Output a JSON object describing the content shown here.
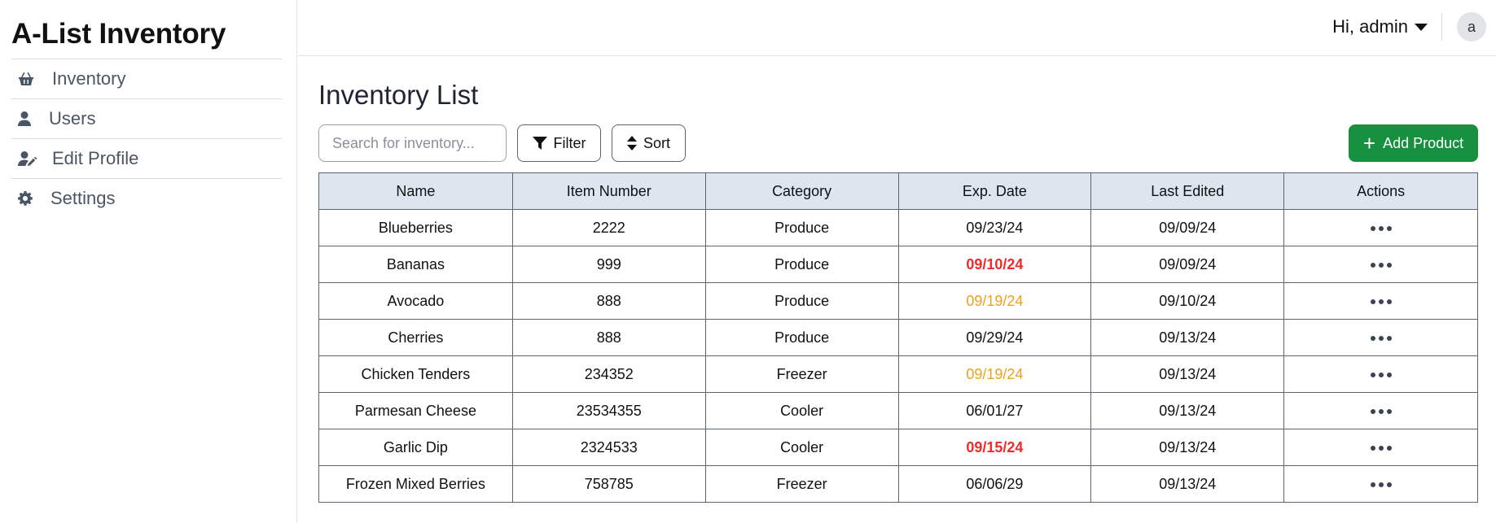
{
  "app": {
    "title": "A-List Inventory"
  },
  "sidebar": {
    "items": [
      {
        "label": "Inventory",
        "icon": "basket-icon"
      },
      {
        "label": "Users",
        "icon": "user-icon"
      },
      {
        "label": "Edit Profile",
        "icon": "user-edit-icon"
      },
      {
        "label": "Settings",
        "icon": "gear-icon"
      }
    ]
  },
  "topbar": {
    "greeting": "Hi, admin",
    "avatar_initial": "a"
  },
  "main": {
    "title": "Inventory List",
    "search_placeholder": "Search for inventory...",
    "filter_label": "Filter",
    "sort_label": "Sort",
    "add_label": "Add Product"
  },
  "table": {
    "columns": [
      "Name",
      "Item Number",
      "Category",
      "Exp. Date",
      "Last Edited",
      "Actions"
    ],
    "rows": [
      {
        "name": "Blueberries",
        "item_number": "2222",
        "category": "Produce",
        "exp_date": "09/23/24",
        "exp_status": "normal",
        "last_edited": "09/09/24"
      },
      {
        "name": "Bananas",
        "item_number": "999",
        "category": "Produce",
        "exp_date": "09/10/24",
        "exp_status": "expired",
        "last_edited": "09/09/24"
      },
      {
        "name": "Avocado",
        "item_number": "888",
        "category": "Produce",
        "exp_date": "09/19/24",
        "exp_status": "warning",
        "last_edited": "09/10/24"
      },
      {
        "name": "Cherries",
        "item_number": "888",
        "category": "Produce",
        "exp_date": "09/29/24",
        "exp_status": "normal",
        "last_edited": "09/13/24"
      },
      {
        "name": "Chicken Tenders",
        "item_number": "234352",
        "category": "Freezer",
        "exp_date": "09/19/24",
        "exp_status": "warning",
        "last_edited": "09/13/24"
      },
      {
        "name": "Parmesan Cheese",
        "item_number": "23534355",
        "category": "Cooler",
        "exp_date": "06/01/27",
        "exp_status": "normal",
        "last_edited": "09/13/24"
      },
      {
        "name": "Garlic Dip",
        "item_number": "2324533",
        "category": "Cooler",
        "exp_date": "09/15/24",
        "exp_status": "expired",
        "last_edited": "09/13/24"
      },
      {
        "name": "Frozen Mixed Berries",
        "item_number": "758785",
        "category": "Freezer",
        "exp_date": "06/06/29",
        "exp_status": "normal",
        "last_edited": "09/13/24"
      }
    ]
  },
  "colors": {
    "accent_green": "#17913f",
    "header_bg": "#dde5ef",
    "expired_red": "#ef2b2b",
    "warning_amber": "#eda21a"
  }
}
